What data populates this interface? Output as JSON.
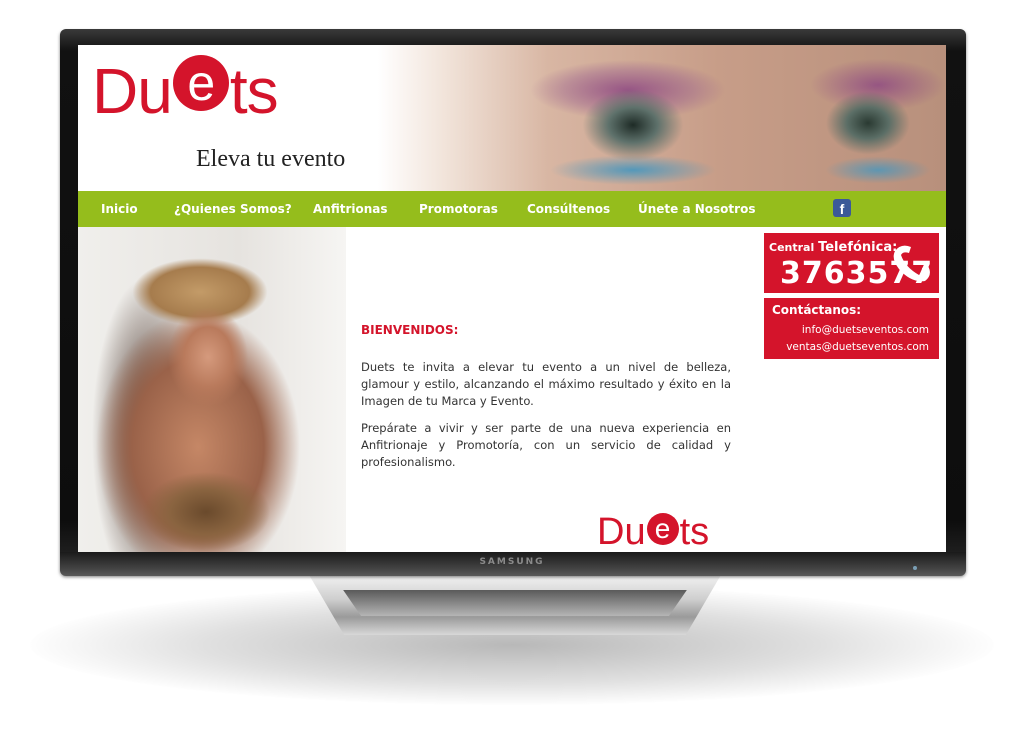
{
  "monitor": {
    "brand": "SAMSUNG"
  },
  "header": {
    "logo_prefix": "Du",
    "logo_e": "e",
    "logo_suffix": "ts",
    "slogan": "Eleva tu evento"
  },
  "nav": {
    "items": [
      "Inicio",
      "¿Quienes Somos?",
      "Anfitrionas",
      "Promotoras",
      "Consúltenos",
      "Únete a Nosotros"
    ],
    "social_icon": "facebook-icon",
    "social_letter": "f"
  },
  "content": {
    "heading": "BIENVENIDOS:",
    "paragraph_1": "Duets te invita a elevar tu evento a un nivel de belleza, glamour y estilo, alcanzando el máximo resultado y éxito en la Imagen de tu Marca y Evento.",
    "paragraph_2": "Prepárate a vivir y ser parte de una nueva experiencia en Anfitrionaje y Promotoría, con un servicio de calidad y profesionalismo."
  },
  "phone": {
    "label_small": "Central",
    "label_big": "Telefónica:",
    "number": "3763577",
    "icon": "phone-icon"
  },
  "contact": {
    "title": "Contáctanos:",
    "emails": [
      "info@duetseventos.com",
      "ventas@duetseventos.com"
    ]
  },
  "colors": {
    "brand_red": "#d4142b",
    "nav_green": "#95bd1c",
    "facebook_blue": "#3b5998"
  }
}
